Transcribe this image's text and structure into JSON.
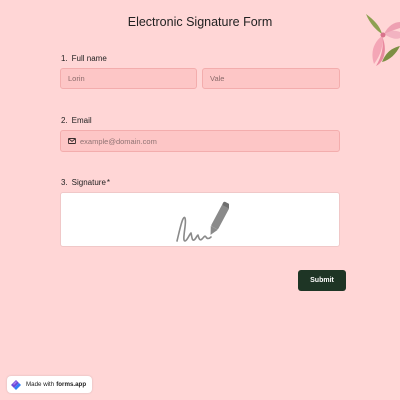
{
  "form": {
    "title": "Electronic Signature Form",
    "accent_color": "#1e3525",
    "background_color": "#ffd6d6"
  },
  "questions": {
    "full_name": {
      "number": "1.",
      "label": "Full name",
      "first_value": "Lorin",
      "last_value": "Vale"
    },
    "email": {
      "number": "2.",
      "label": "Email",
      "placeholder": "example@domain.com",
      "icon": "envelope-icon"
    },
    "signature": {
      "number": "3.",
      "label": "Signature",
      "required_marker": "*",
      "icon": "signature-pen-icon"
    }
  },
  "submit": {
    "label": "Submit"
  },
  "footer": {
    "made_with": "Made with",
    "brand": "forms.app",
    "icon": "forms-app-logo"
  },
  "decor": {
    "icon": "flower-icon"
  }
}
